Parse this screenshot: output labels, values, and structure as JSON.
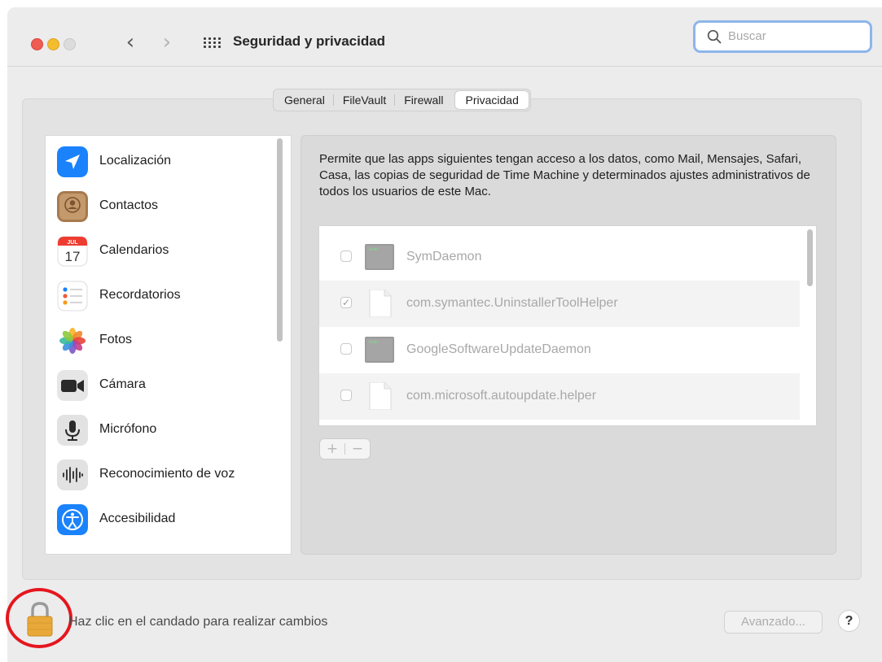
{
  "window": {
    "title": "Seguridad y privacidad",
    "search_placeholder": "Buscar"
  },
  "tabs": [
    {
      "label": "General",
      "active": false
    },
    {
      "label": "FileVault",
      "active": false
    },
    {
      "label": "Firewall",
      "active": false
    },
    {
      "label": "Privacidad",
      "active": true
    }
  ],
  "sidebar": {
    "items": [
      {
        "label": "Localización",
        "icon": "location-arrow-icon"
      },
      {
        "label": "Contactos",
        "icon": "contacts-icon"
      },
      {
        "label": "Calendarios",
        "icon": "calendar-icon",
        "icon_month": "JUL",
        "icon_day": "17"
      },
      {
        "label": "Recordatorios",
        "icon": "reminders-icon"
      },
      {
        "label": "Fotos",
        "icon": "photos-icon"
      },
      {
        "label": "Cámara",
        "icon": "camera-icon"
      },
      {
        "label": "Micrófono",
        "icon": "microphone-icon"
      },
      {
        "label": "Reconocimiento de voz",
        "icon": "speech-recognition-icon"
      },
      {
        "label": "Accesibilidad",
        "icon": "accessibility-icon"
      }
    ]
  },
  "privacy": {
    "description": "Permite que las apps siguientes tengan acceso a los datos, como Mail, Mensajes, Safari, Casa, las copias de seguridad de Time Machine y determinados ajustes administrativos de todos los usuarios de este Mac.",
    "apps": [
      {
        "name": "SymDaemon",
        "checked": false,
        "icon": "terminal-executable-icon"
      },
      {
        "name": "com.symantec.UninstallerToolHelper",
        "checked": true,
        "icon": "generic-file-icon"
      },
      {
        "name": "GoogleSoftwareUpdateDaemon",
        "checked": false,
        "icon": "terminal-executable-icon"
      },
      {
        "name": "com.microsoft.autoupdate.helper",
        "checked": false,
        "icon": "generic-file-icon"
      }
    ],
    "add_label": "+",
    "remove_label": "−"
  },
  "footer": {
    "lock_text": "Haz clic en el candado para realizar cambios",
    "advanced_label": "Avanzado...",
    "help_label": "?"
  },
  "colors": {
    "accent_blue": "#1a82fb",
    "annotation_red": "#e5161e",
    "lock_gold": "#e9a93a"
  }
}
